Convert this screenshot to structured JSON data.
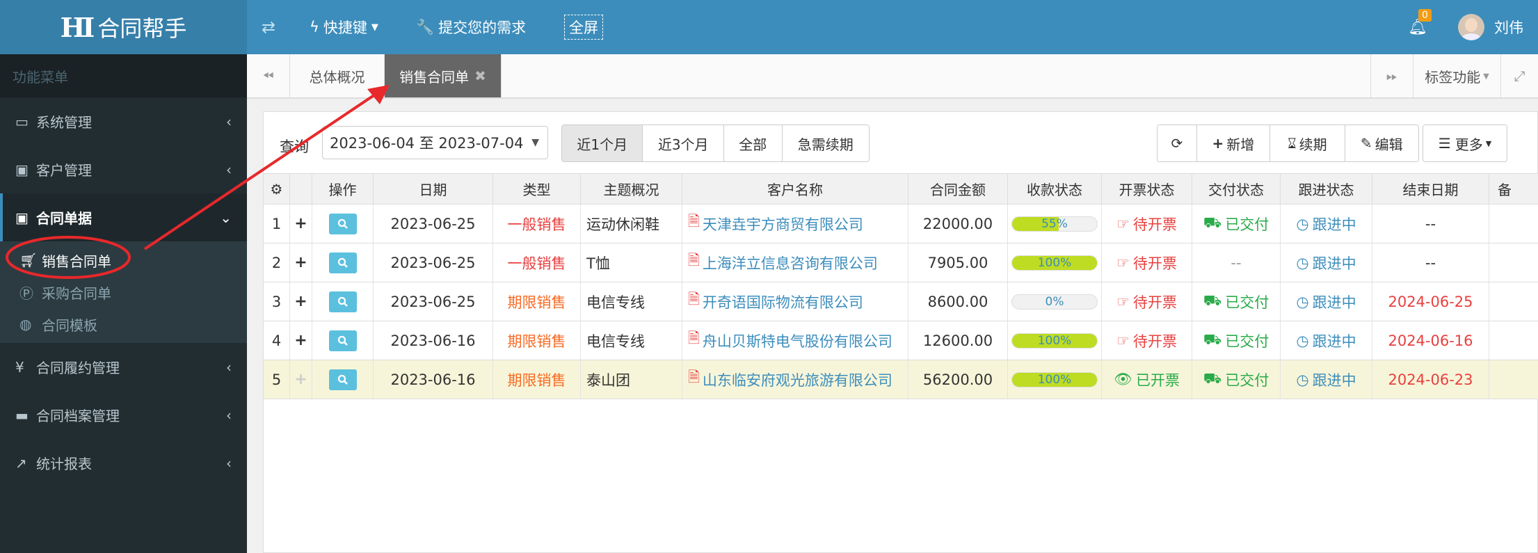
{
  "app": {
    "logo_mark": "HI",
    "title": "合同帮手"
  },
  "topbar": {
    "toggle_icon": "switch-icon",
    "shortcuts": "快捷键",
    "feedback": "提交您的需求",
    "fullscreen": "全屏",
    "notification_count": "0",
    "user_name": "刘伟"
  },
  "sidebar": {
    "title": "功能菜单",
    "items": [
      {
        "label": "系统管理",
        "icon": "monitor-icon"
      },
      {
        "label": "客户管理",
        "icon": "briefcase-icon"
      },
      {
        "label": "合同单据",
        "icon": "suitcase-icon",
        "expanded": true
      },
      {
        "label": "合同履约管理",
        "icon": "yen-icon"
      },
      {
        "label": "合同档案管理",
        "icon": "folder-icon"
      },
      {
        "label": "统计报表",
        "icon": "line-chart-icon"
      }
    ],
    "sub_items": [
      {
        "label": "销售合同单",
        "icon": "cart-icon",
        "active": true
      },
      {
        "label": "采购合同单",
        "icon": "p-circle-icon"
      },
      {
        "label": "合同模板",
        "icon": "palette-icon"
      }
    ]
  },
  "tabs": {
    "items": [
      {
        "label": "总体概况"
      },
      {
        "label": "销售合同单",
        "active": true,
        "close": "✖"
      }
    ],
    "tag_functions": "标签功能"
  },
  "toolbar": {
    "query_label": "查询",
    "date_range": "2023-06-04 至 2023-07-04",
    "filters": [
      "近1个月",
      "近3个月",
      "全部",
      "急需续期"
    ],
    "selected_filter": "近1个月",
    "refresh_icon": "refresh-icon",
    "add": "新增",
    "renew": "续期",
    "edit": "编辑",
    "more": "更多"
  },
  "table": {
    "headers": [
      "操作",
      "日期",
      "类型",
      "主题概况",
      "客户名称",
      "合同金额",
      "收款状态",
      "开票状态",
      "交付状态",
      "跟进状态",
      "结束日期",
      "备"
    ],
    "rows": [
      {
        "no": "1",
        "date": "2023-06-25",
        "type": "一般销售",
        "type_color": "red",
        "subject": "运动休闲鞋",
        "customer": "天津垚宇方商贸有限公司",
        "amount": "22000.00",
        "progress": 55,
        "progress_label": "55%",
        "invoice": "待开票",
        "delivery": "已交付",
        "follow": "跟进中",
        "end_date": "--"
      },
      {
        "no": "2",
        "date": "2023-06-25",
        "type": "一般销售",
        "type_color": "red",
        "subject": "T恤",
        "customer": "上海洋立信息咨询有限公司",
        "amount": "7905.00",
        "progress": 100,
        "progress_label": "100%",
        "invoice": "待开票",
        "delivery": "--",
        "follow": "跟进中",
        "end_date": "--"
      },
      {
        "no": "3",
        "date": "2023-06-25",
        "type": "期限销售",
        "type_color": "orange",
        "subject": "电信专线",
        "customer": "开奇语国际物流有限公司",
        "amount": "8600.00",
        "progress": 0,
        "progress_label": "0%",
        "invoice": "待开票",
        "delivery": "已交付",
        "follow": "跟进中",
        "end_date": "2024-06-25"
      },
      {
        "no": "4",
        "date": "2023-06-16",
        "type": "期限销售",
        "type_color": "orange",
        "subject": "电信专线",
        "customer": "舟山贝斯特电气股份有限公司",
        "amount": "12600.00",
        "progress": 100,
        "progress_label": "100%",
        "invoice": "待开票",
        "delivery": "已交付",
        "follow": "跟进中",
        "end_date": "2024-06-16"
      },
      {
        "no": "5",
        "date": "2023-06-16",
        "type": "期限销售",
        "type_color": "orange",
        "subject": "泰山团",
        "customer": "山东临安府观光旅游有限公司",
        "amount": "56200.00",
        "progress": 100,
        "progress_label": "100%",
        "invoice": "已开票",
        "delivery": "已交付",
        "follow": "跟进中",
        "end_date": "2024-06-23",
        "highlight": true
      }
    ]
  },
  "colors": {
    "accent": "#3c8dbc",
    "sidebar": "#222d32",
    "annotation": "#e8282b"
  }
}
